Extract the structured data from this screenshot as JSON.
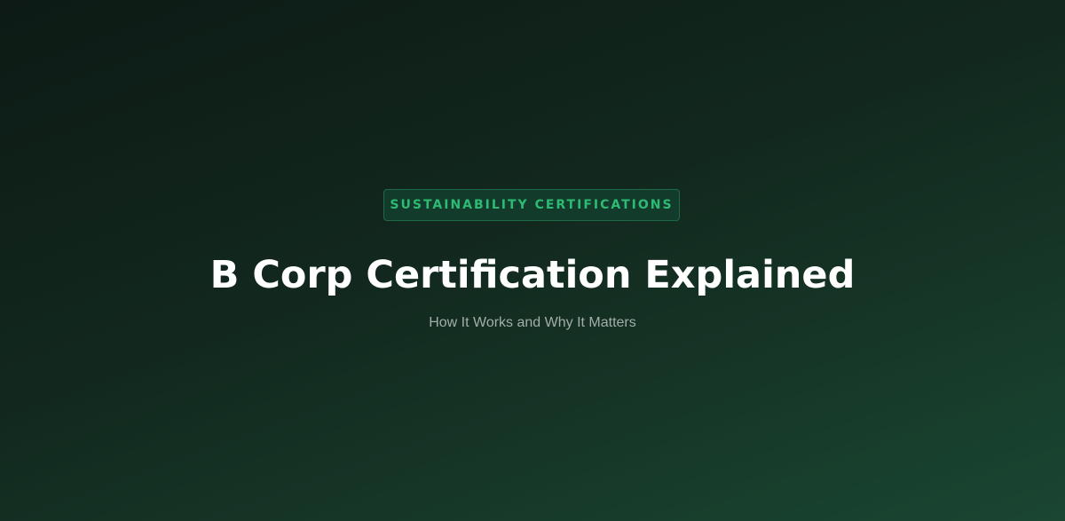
{
  "hero": {
    "tag": "SUSTAINABILITY CERTIFICATIONS",
    "title": "B Corp Certification Explained",
    "subtitle": "How It Works and Why It Matters"
  },
  "colors": {
    "background_dark": "#0d1a15",
    "background_light": "#1a4632",
    "accent": "#2dbb74",
    "title": "#ffffff",
    "subtitle": "#a3aea8"
  }
}
